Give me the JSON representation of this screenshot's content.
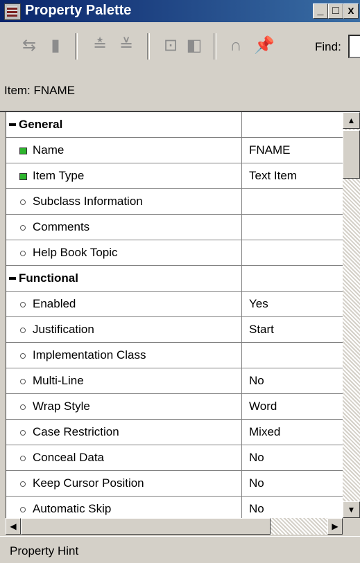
{
  "window": {
    "title": "Property Palette",
    "minimize": "_",
    "maximize": "□",
    "close": "x"
  },
  "toolbar": {
    "find_label": "Find:",
    "find_value": ""
  },
  "item_line": "Item: FNAME",
  "properties": {
    "general": "General",
    "name": {
      "label": "Name",
      "value": "FNAME"
    },
    "item_type": {
      "label": "Item Type",
      "value": "Text Item"
    },
    "subclass": {
      "label": "Subclass Information",
      "value": ""
    },
    "comments": {
      "label": "Comments",
      "value": ""
    },
    "help_book": {
      "label": "Help Book Topic",
      "value": ""
    },
    "functional": "Functional",
    "enabled": {
      "label": "Enabled",
      "value": "Yes"
    },
    "justification": {
      "label": "Justification",
      "value": "Start"
    },
    "impl_class": {
      "label": "Implementation Class",
      "value": ""
    },
    "multi_line": {
      "label": "Multi-Line",
      "value": "No"
    },
    "wrap_style": {
      "label": "Wrap Style",
      "value": "Word"
    },
    "case_restriction": {
      "label": "Case Restriction",
      "value": "Mixed"
    },
    "conceal_data": {
      "label": "Conceal Data",
      "value": "No"
    },
    "keep_cursor": {
      "label": "Keep Cursor Position",
      "value": "No"
    },
    "automatic_skip": {
      "label": "Automatic Skip",
      "value": "No"
    }
  },
  "hint": "Property Hint"
}
